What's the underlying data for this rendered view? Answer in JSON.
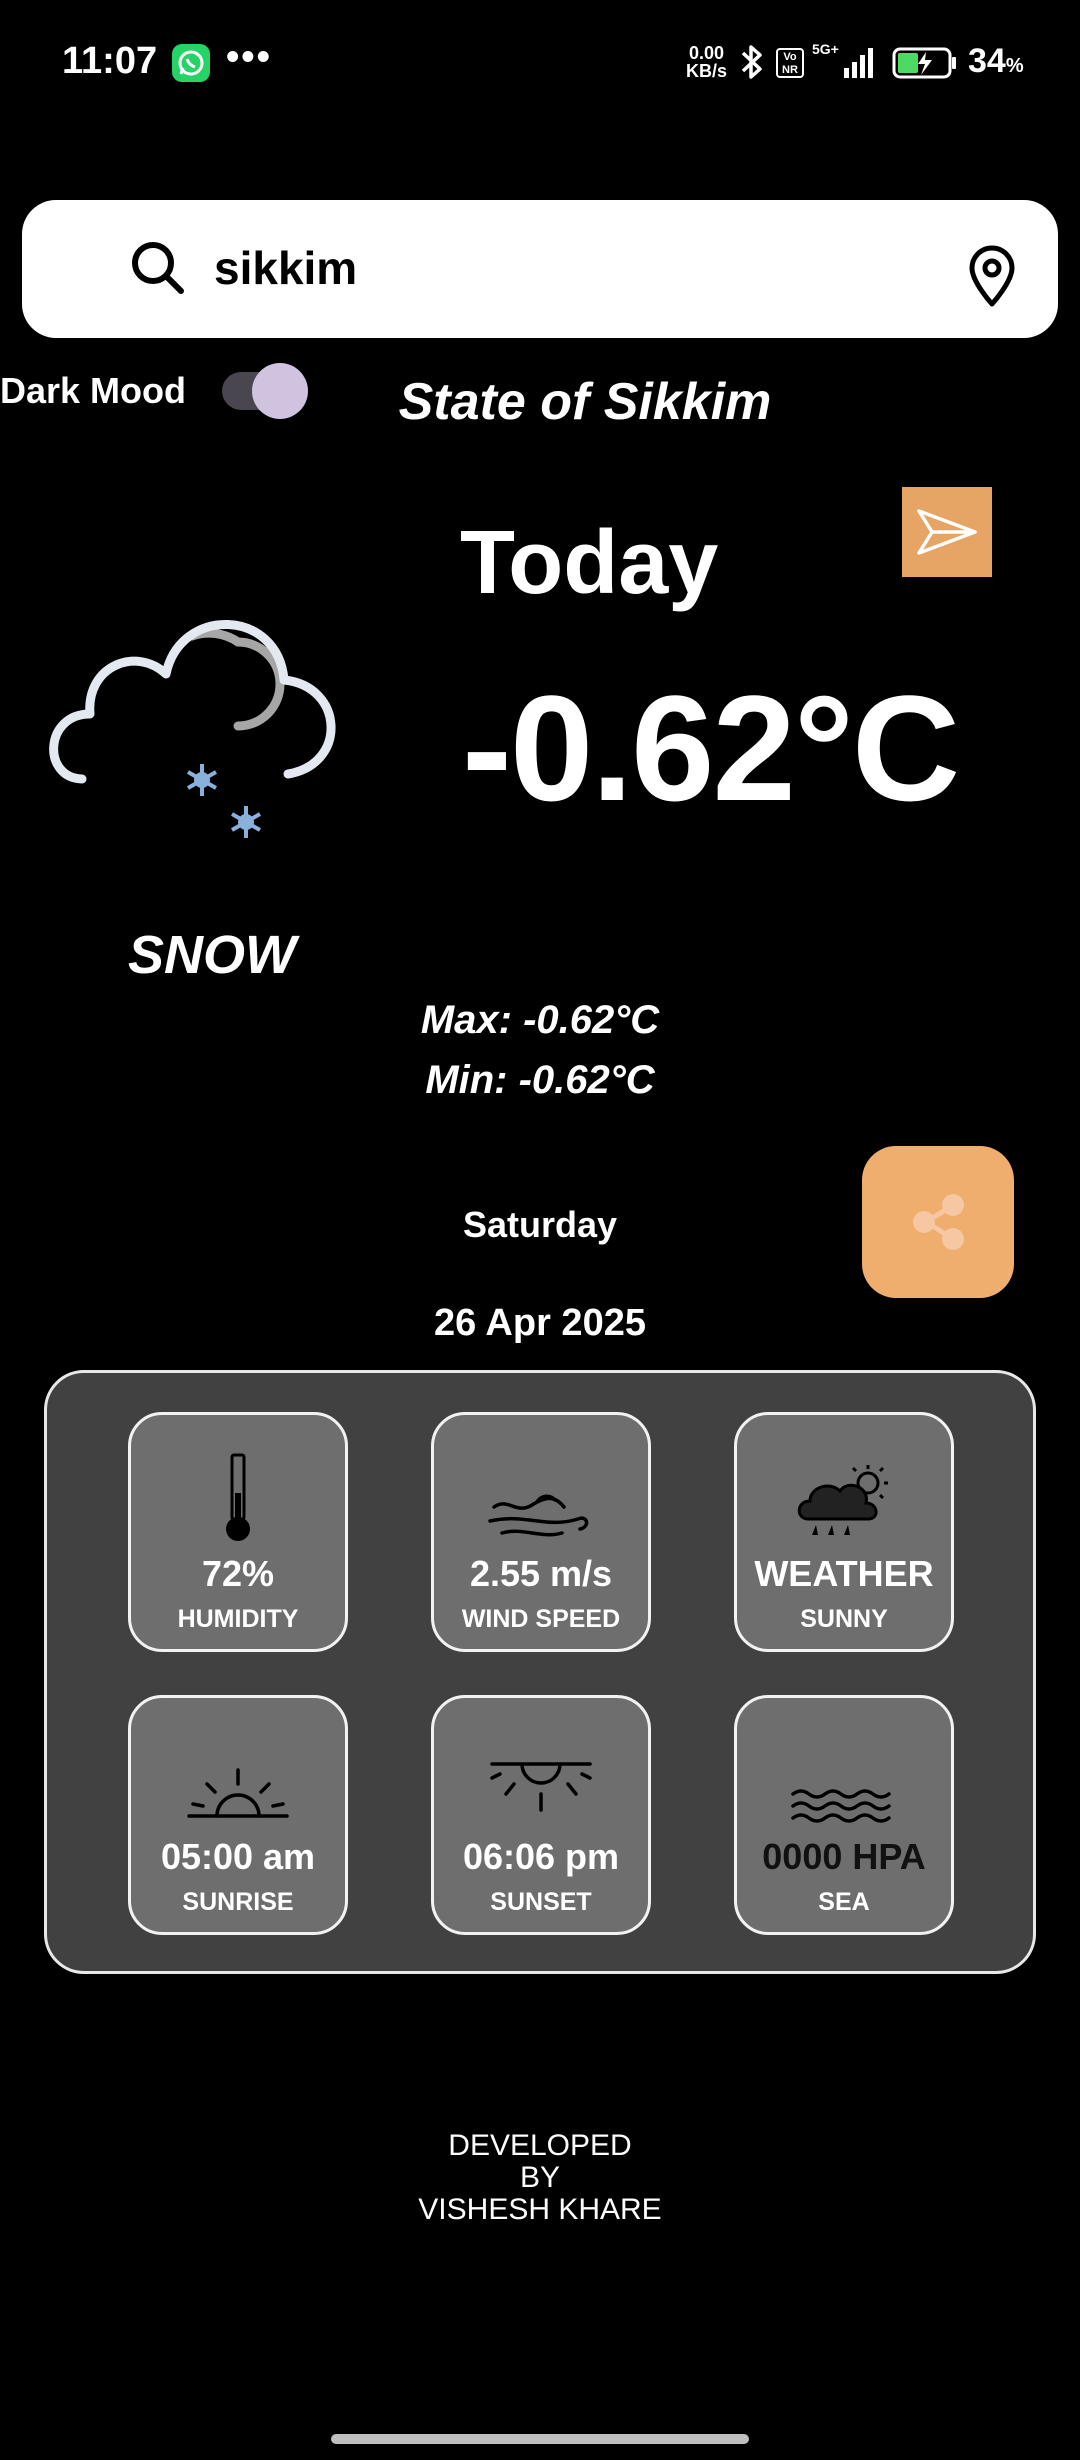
{
  "status_bar": {
    "time": "11:07",
    "dots": "•••",
    "net_speed_value": "0.00",
    "net_speed_unit": "KB/s",
    "vonr": "Vo NR",
    "network": "5G+",
    "battery_pct": "34",
    "battery_unit": "%"
  },
  "search": {
    "value": "sikkim",
    "placeholder": ""
  },
  "dark_mode": {
    "label": "Dark Mood",
    "enabled": true
  },
  "location": {
    "title": "State of Sikkim"
  },
  "today": {
    "label": "Today",
    "temperature": "-0.62°C",
    "condition": "SNOW",
    "max": "Max: -0.62°C",
    "min": "Min: -0.62°C",
    "day": "Saturday",
    "date": "26 Apr 2025"
  },
  "details": [
    {
      "value": "72%",
      "label": "HUMIDITY",
      "icon": "thermometer-icon"
    },
    {
      "value": "2.55 m/s",
      "label": "WIND SPEED",
      "icon": "wind-icon"
    },
    {
      "value": "WEATHER",
      "label": "SUNNY",
      "icon": "storm-cloud-icon"
    },
    {
      "value": "05:00 am",
      "label": "SUNRISE",
      "icon": "sunrise-icon"
    },
    {
      "value": "06:06 pm",
      "label": "SUNSET",
      "icon": "sunset-icon"
    },
    {
      "value": "0000 HPA",
      "label": "SEA",
      "icon": "sea-waves-icon"
    }
  ],
  "footer": {
    "line1": "DEVELOPED",
    "line2": "BY",
    "line3": "VISHESH KHARE"
  },
  "colors": {
    "background": "#000000",
    "accent_orange": "#efae6d",
    "panel": "#414141",
    "tile": "#6e6e6e",
    "toggle_thumb": "#cfc3e0"
  }
}
